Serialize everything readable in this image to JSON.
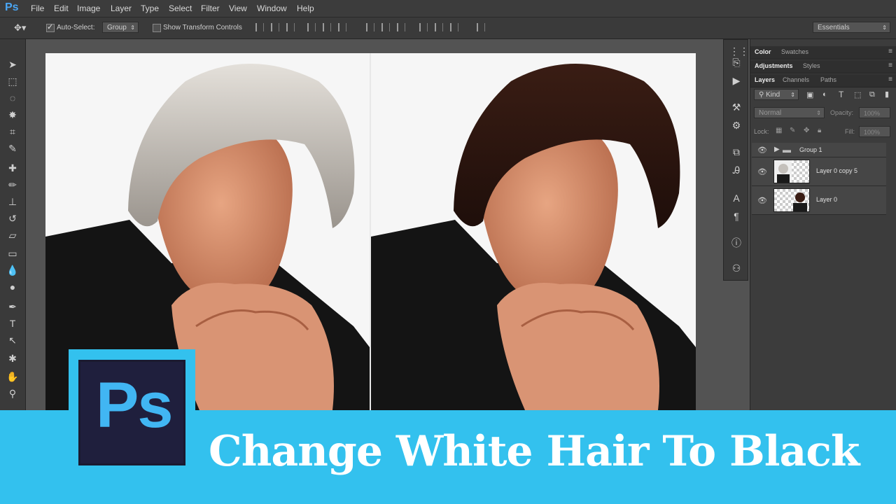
{
  "app": {
    "logo": "Ps"
  },
  "menu": [
    "File",
    "Edit",
    "Image",
    "Layer",
    "Type",
    "Select",
    "Filter",
    "View",
    "Window",
    "Help"
  ],
  "options_bar": {
    "auto_select_label": "Auto-Select:",
    "auto_select_value": "Group",
    "show_transform_label": "Show Transform Controls",
    "workspace": "Essentials"
  },
  "panels": {
    "group1_tabs": [
      "Color",
      "Swatches"
    ],
    "group2_tabs": [
      "Adjustments",
      "Styles"
    ],
    "layers_tabs": [
      "Layers",
      "Channels",
      "Paths"
    ],
    "filter_kind": "Kind",
    "blend_mode": "Normal",
    "opacity_label": "Opacity:",
    "opacity_value": "100%",
    "lock_label": "Lock:",
    "fill_label": "Fill:",
    "fill_value": "100%",
    "layers": [
      {
        "name": "Group 1",
        "type": "group"
      },
      {
        "name": "Layer 0 copy 5",
        "type": "layer"
      },
      {
        "name": "Layer 0",
        "type": "layer"
      }
    ]
  },
  "banner": {
    "logo_text": "Ps",
    "title": "Change White Hair To Black"
  },
  "colors": {
    "banner": "#33c1ee",
    "logo_bg": "#1f1f3d",
    "logo_text": "#41b6f3"
  }
}
